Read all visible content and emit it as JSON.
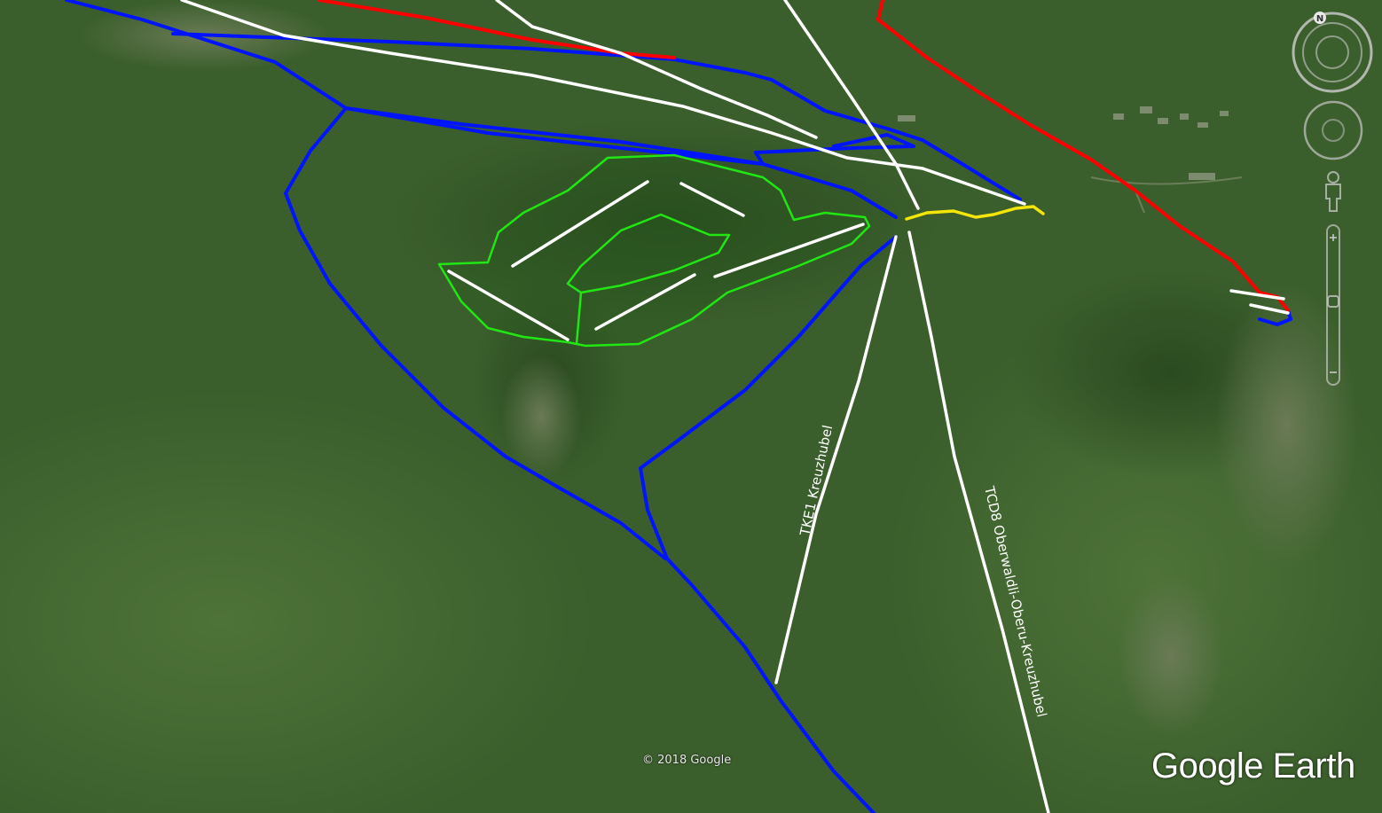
{
  "map": {
    "lift_labels": {
      "tke1": "TKE1 Kreuzhubel",
      "tcd8": "TCD8 Oberwaldli-Oberu-Kreuzhubel"
    },
    "copyright": "© 2018 Google",
    "brand": "Google Earth",
    "compass_letter": "N",
    "colors": {
      "terrain": "#3b5f2c",
      "blue_run": "#0014ff",
      "red_run": "#ff0000",
      "lift": "#ffffff",
      "green_area": "#22e614",
      "yellow_path": "#f5e60a"
    }
  }
}
